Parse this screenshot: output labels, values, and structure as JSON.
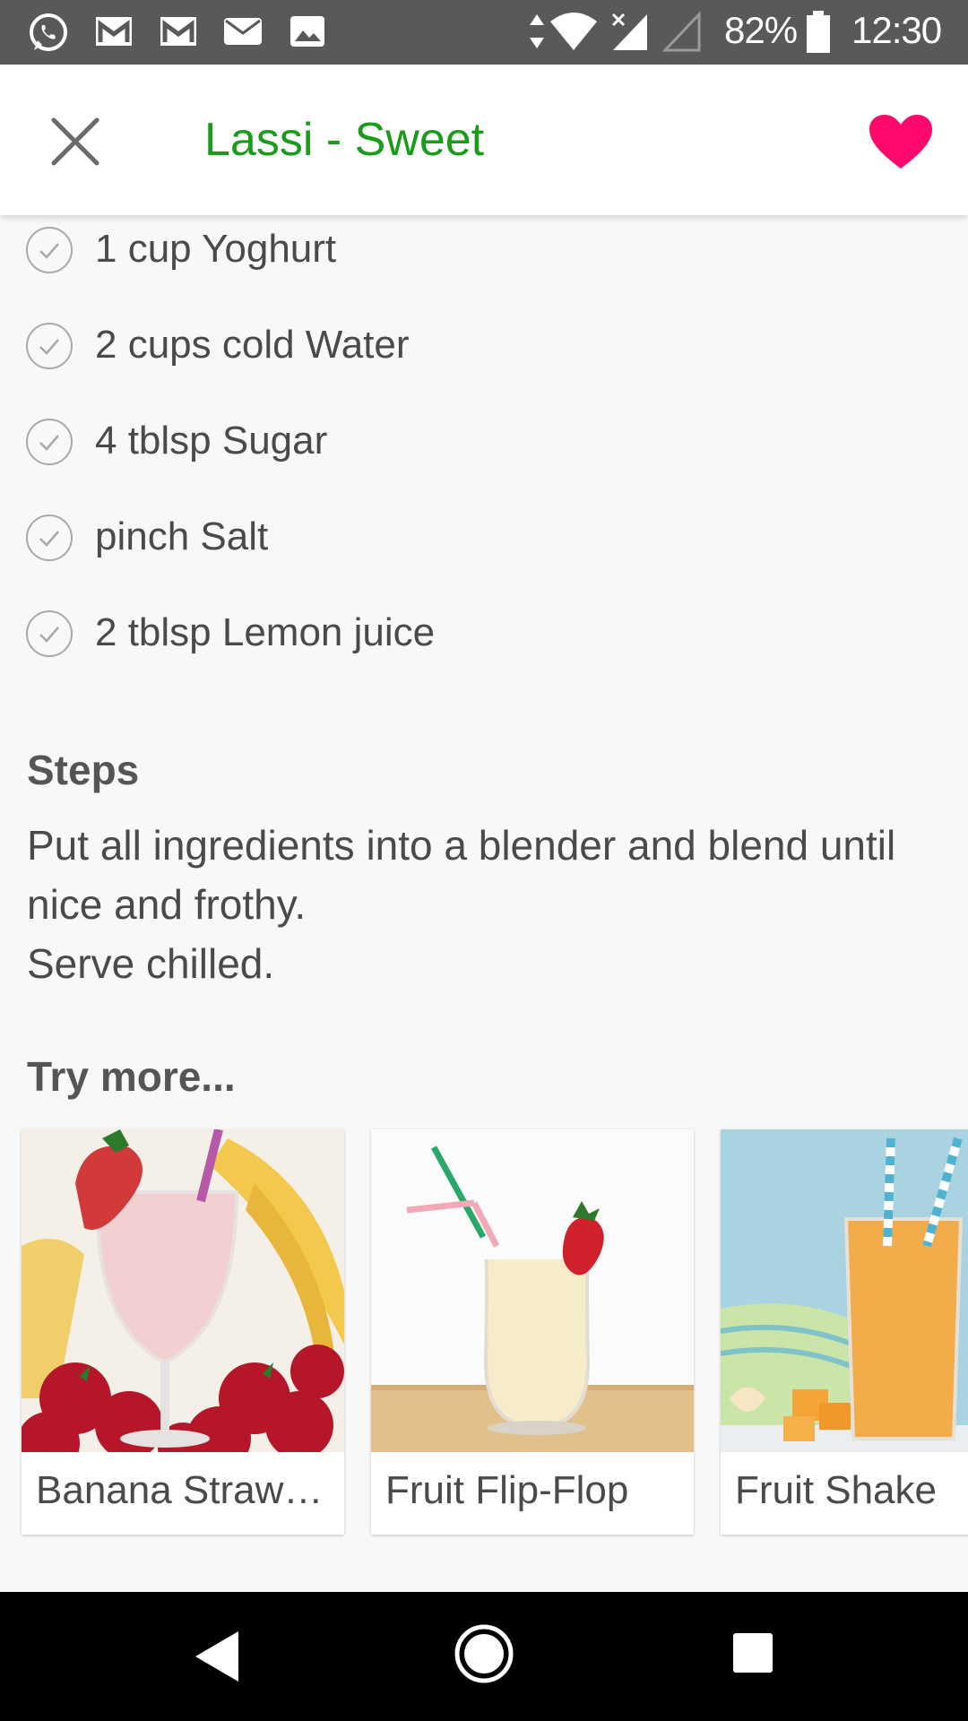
{
  "status_bar": {
    "battery": "82%",
    "time": "12:30",
    "left_icons": [
      "whatsapp-icon",
      "gmail-icon",
      "gmail-icon",
      "mail-icon",
      "gallery-icon"
    ],
    "right_icons": [
      "data-arrows-icon",
      "wifi-icon",
      "signal-icon",
      "signal-empty-icon",
      "battery-icon"
    ]
  },
  "toolbar": {
    "title": "Lassi - Sweet",
    "title_color": "#1a9c1a",
    "favorite_color": "#ff0a6c"
  },
  "ingredients": [
    "1 cup Yoghurt",
    "2 cups cold Water",
    "4 tblsp Sugar",
    "pinch Salt",
    "2 tblsp Lemon juice"
  ],
  "steps": {
    "heading": "Steps",
    "text": "Put all ingredients into a blender and blend until nice and frothy.\nServe chilled."
  },
  "try_more": {
    "heading": "Try more...",
    "cards": [
      {
        "label": "Banana Strawberry Smoothie"
      },
      {
        "label": "Fruit Flip-Flop"
      },
      {
        "label": "Fruit Shake"
      }
    ]
  },
  "nav_bar": {
    "icons": [
      "back-icon",
      "home-icon",
      "recents-icon"
    ]
  }
}
